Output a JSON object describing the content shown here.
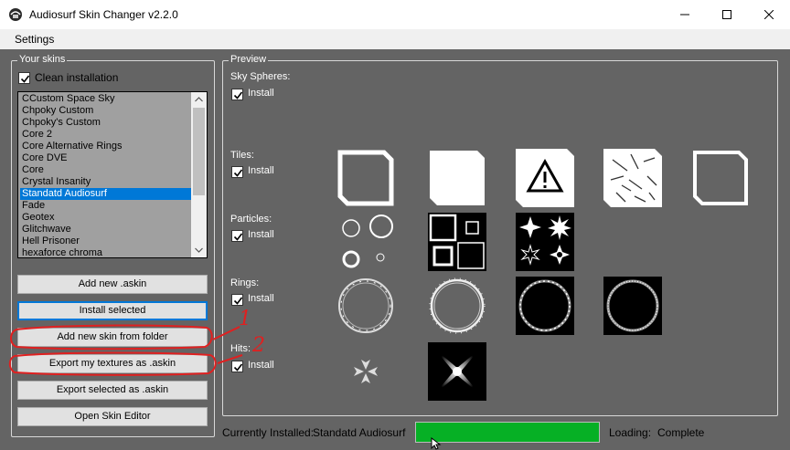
{
  "window": {
    "title": "Audiosurf Skin Changer v2.2.0",
    "controls": [
      "minimize-icon",
      "maximize-icon",
      "close-icon"
    ]
  },
  "menu": {
    "settings": "Settings"
  },
  "skins_panel": {
    "legend": "Your skins",
    "clean_installation": {
      "label": "Clean installation",
      "checked": true
    },
    "skins": [
      "CCustom Space Sky",
      "Chpoky Custom",
      "Chpoky's Custom",
      "Core 2",
      "Core Alternative Rings",
      "Core DVE",
      "Core",
      "Crystal Insanity",
      "Standatd Audiosurf",
      "Fade",
      "Geotex",
      "Glitchwave",
      "Hell Prisoner",
      "hexaforce chroma"
    ],
    "selected_skin": "Standatd Audiosurf",
    "buttons": {
      "add_new": "Add new .askin",
      "install_selected": "Install selected",
      "add_from_folder": "Add new skin from folder",
      "export_textures": "Export my textures as .askin",
      "export_selected": "Export selected as .askin",
      "open_editor": "Open Skin Editor"
    }
  },
  "preview": {
    "legend": "Preview",
    "sections": [
      {
        "key": "sky",
        "title": "Sky Spheres:",
        "install_label": "Install",
        "checked": true
      },
      {
        "key": "tiles",
        "title": "Tiles:",
        "install_label": "Install",
        "checked": true
      },
      {
        "key": "particles",
        "title": "Particles:",
        "install_label": "Install",
        "checked": true
      },
      {
        "key": "rings",
        "title": "Rings:",
        "install_label": "Install",
        "checked": true
      },
      {
        "key": "hits",
        "title": "Hits:",
        "install_label": "Install",
        "checked": true
      }
    ]
  },
  "status": {
    "currently_installed_label": "Currently Installed:",
    "currently_installed_value": "Standatd Audiosurf",
    "loading_label": "Loading:",
    "loading_value": "Complete",
    "progress_fraction": 1.0
  },
  "annotations": {
    "mark_1": "1",
    "mark_2": "2",
    "color": "#e02020"
  },
  "colors": {
    "background": "#646464",
    "selection": "#0078d7",
    "progress": "#06b025"
  }
}
